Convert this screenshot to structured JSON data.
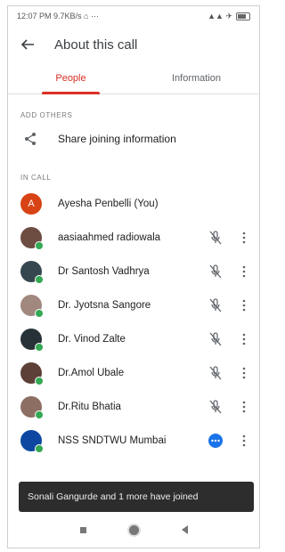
{
  "status_bar": {
    "time_info": "12:07 PM  9.7KB/s ⌂ ···",
    "signal": "▲▲ ✈"
  },
  "header": {
    "title": "About this call"
  },
  "tabs": [
    {
      "label": "People",
      "active": true
    },
    {
      "label": "Information",
      "active": false
    }
  ],
  "sections": {
    "add_others": "ADD OTHERS",
    "in_call": "IN CALL"
  },
  "share": {
    "label": "Share joining information"
  },
  "participants": [
    {
      "name": "Ayesha Penbelli (You)",
      "avatar_letter": "A",
      "avatar_color": "#d84315",
      "show_controls": false
    },
    {
      "name": "aasiaahmed radiowala",
      "avatar_color": "#6d4c41",
      "show_controls": true
    },
    {
      "name": "Dr Santosh Vadhrya",
      "avatar_color": "#37474f",
      "show_controls": true
    },
    {
      "name": "Dr. Jyotsna Sangore",
      "avatar_color": "#a1887f",
      "show_controls": true
    },
    {
      "name": "Dr. Vinod Zalte",
      "avatar_color": "#263238",
      "show_controls": true
    },
    {
      "name": "Dr.Amol Ubale",
      "avatar_color": "#5d4037",
      "show_controls": true
    },
    {
      "name": "Dr.Ritu Bhatia",
      "avatar_color": "#8d6e63",
      "show_controls": true
    },
    {
      "name": "NSS SNDTWU Mumbai",
      "avatar_color": "#0d47a1",
      "show_controls": true
    }
  ],
  "snackbar": {
    "text": "Sonali Gangurde and 1 more have joined"
  },
  "colors": {
    "accent": "#d93025",
    "online": "#34a853"
  }
}
